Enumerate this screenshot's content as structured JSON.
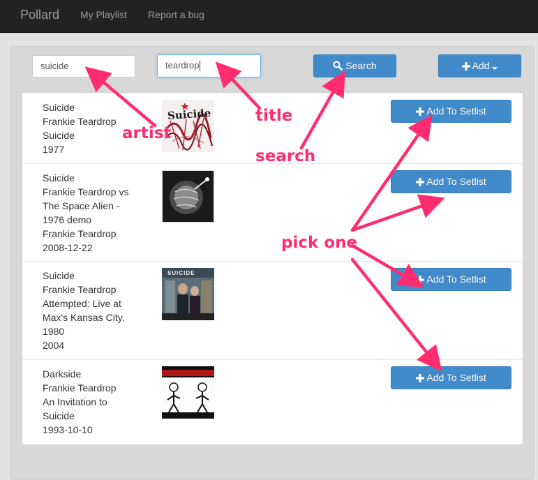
{
  "navbar": {
    "brand": "Pollard",
    "links": [
      "My Playlist",
      "Report a bug"
    ]
  },
  "search": {
    "artist_value": "suicide",
    "title_value": "teardrop",
    "search_label": "Search",
    "add_label": "Add"
  },
  "results": [
    {
      "lines": [
        "Suicide",
        "Frankie Teardrop",
        "Suicide",
        "1977"
      ],
      "cover_text": "Suicide",
      "button": "Add To Setlist"
    },
    {
      "lines": [
        "Suicide",
        "Frankie Teardrop vs",
        "The Space Alien -",
        "1976 demo",
        "Frankie Teardrop",
        "2008-12-22"
      ],
      "button": "Add To Setlist"
    },
    {
      "lines": [
        "Suicide",
        "Frankie Teardrop",
        "Attempted: Live at",
        "Max's Kansas City,",
        "1980",
        "2004"
      ],
      "cover_text": "SUICIDE",
      "button": "Add To Setlist"
    },
    {
      "lines": [
        "Darkside",
        "Frankie Teardrop",
        "An Invitation to",
        "Suicide",
        "1993-10-10"
      ],
      "button": "Add To Setlist"
    }
  ],
  "annotations": {
    "artist": "artist",
    "title": "title",
    "search": "search",
    "pick": "pick one"
  },
  "colors": {
    "navbar": "#222222",
    "primary": "#428bca",
    "annotation": "#ff2d6f"
  }
}
